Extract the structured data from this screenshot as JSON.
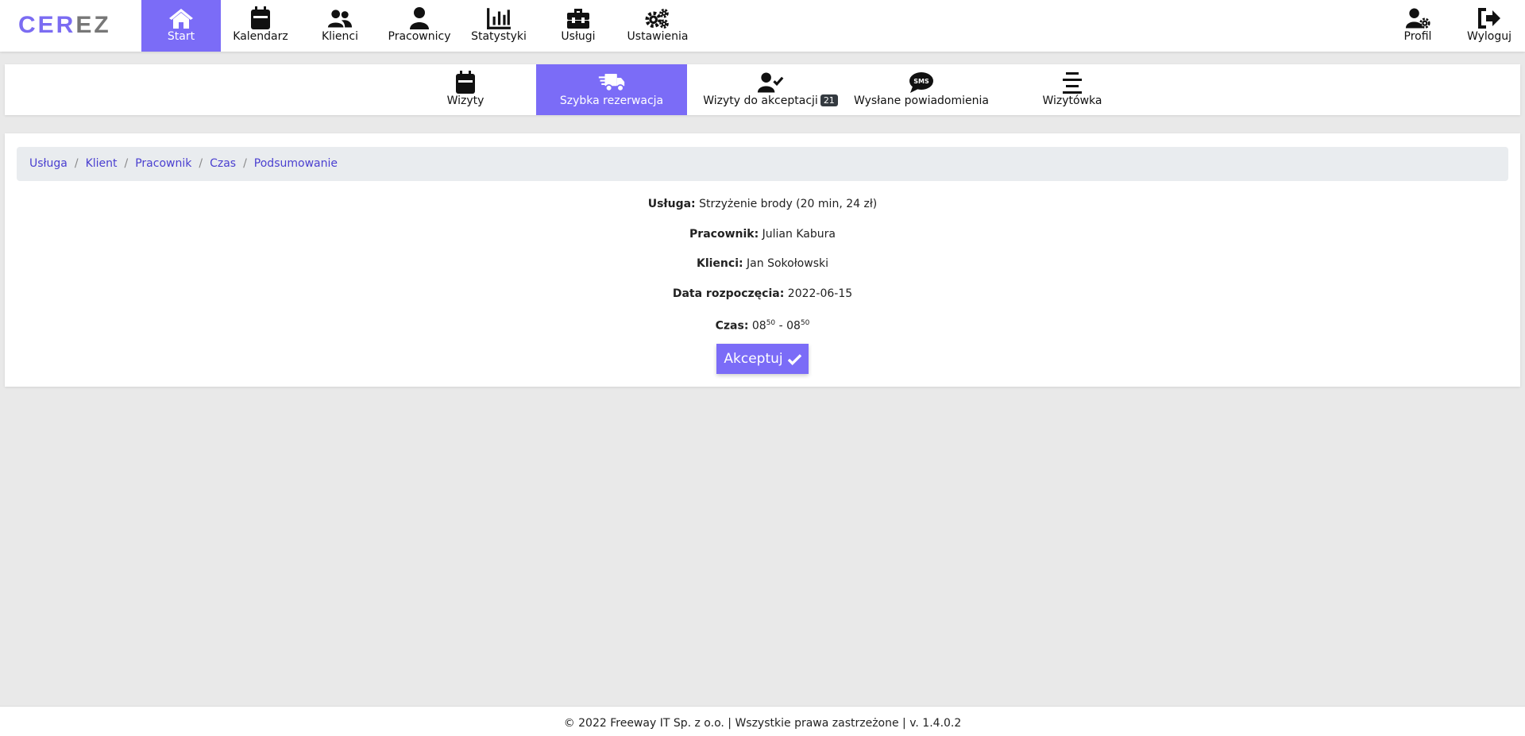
{
  "brand": {
    "logo_part1": "CER",
    "logo_part2": "EZ"
  },
  "topnav": {
    "items": [
      {
        "label": "Start",
        "icon": "home-icon",
        "active": true
      },
      {
        "label": "Kalendarz",
        "icon": "calendar-icon"
      },
      {
        "label": "Klienci",
        "icon": "users-icon"
      },
      {
        "label": "Pracownicy",
        "icon": "user-icon"
      },
      {
        "label": "Statystyki",
        "icon": "bar-chart-icon"
      },
      {
        "label": "Usługi",
        "icon": "toolbox-icon"
      },
      {
        "label": "Ustawienia",
        "icon": "gears-icon"
      }
    ],
    "right": [
      {
        "label": "Profil",
        "icon": "user-gear-icon"
      },
      {
        "label": "Wyloguj",
        "icon": "sign-out-icon"
      }
    ]
  },
  "subnav": {
    "items": [
      {
        "label": "Wizyty",
        "icon": "calendar-icon"
      },
      {
        "label": "Szybka rezerwacja",
        "icon": "shipping-fast-icon",
        "active": true
      },
      {
        "label": "Wizyty do akceptacji",
        "icon": "user-check-icon",
        "badge": "21"
      },
      {
        "label": "Wysłane powiadomienia",
        "icon": "sms-icon"
      },
      {
        "label": "Wizytówka",
        "icon": "align-center-icon"
      }
    ]
  },
  "breadcrumb": [
    "Usługa",
    "Klient",
    "Pracownik",
    "Czas",
    "Podsumowanie"
  ],
  "summary": {
    "service_label": "Usługa:",
    "service_value": "Strzyżenie brody (20 min, 24 zł)",
    "employee_label": "Pracownik:",
    "employee_value": "Julian Kabura",
    "client_label": "Klienci:",
    "client_value": "Jan Sokołowski",
    "start_label": "Data rozpoczęcia:",
    "start_value": "2022-06-15",
    "time_label": "Czas:",
    "time_from_h": "08",
    "time_from_m": "50",
    "time_sep": " - ",
    "time_to_h": "08",
    "time_to_m": "50"
  },
  "accept_button": {
    "label": "Akceptuj",
    "icon": "check-icon"
  },
  "footer": {
    "text": "© 2022 Freeway IT Sp. z o.o. | Wszystkie prawa zastrzeżone | v. 1.4.0.2"
  },
  "colors": {
    "accent": "#7b6cf7",
    "link": "#4a3fd0",
    "background": "#e9e9e9"
  }
}
